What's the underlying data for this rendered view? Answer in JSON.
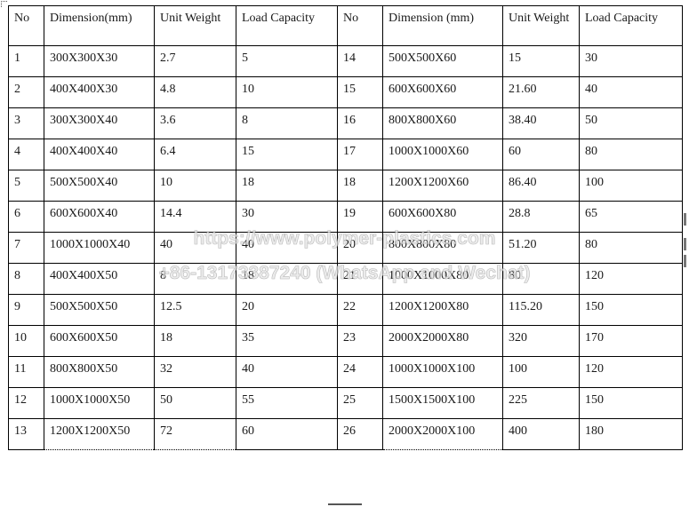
{
  "table": {
    "headers": [
      "No",
      "Dimension(mm)",
      "Unit Weight",
      "Load Capacity",
      "No",
      "Dimension (mm)",
      "Unit Weight",
      "Load Capacity"
    ],
    "rows": [
      [
        "1",
        "300X300X30",
        "2.7",
        "5",
        "14",
        "500X500X60",
        "15",
        "30"
      ],
      [
        "2",
        "400X400X30",
        "4.8",
        "10",
        "15",
        "600X600X60",
        "21.60",
        "40"
      ],
      [
        "3",
        "300X300X40",
        "3.6",
        "8",
        "16",
        "800X800X60",
        "38.40",
        "50"
      ],
      [
        "4",
        "400X400X40",
        "6.4",
        "15",
        "17",
        "1000X1000X60",
        "60",
        "80"
      ],
      [
        "5",
        "500X500X40",
        "10",
        "18",
        "18",
        "1200X1200X60",
        "86.40",
        "100"
      ],
      [
        "6",
        "600X600X40",
        "14.4",
        "30",
        "19",
        "600X600X80",
        "28.8",
        "65"
      ],
      [
        "7",
        "1000X1000X40",
        "40",
        "40",
        "20",
        "800X800X80",
        "51.20",
        "80"
      ],
      [
        "8",
        "400X400X50",
        "8",
        "18",
        "21",
        "1000X1000X80",
        "80",
        "120"
      ],
      [
        "9",
        "500X500X50",
        "12.5",
        "20",
        "22",
        "1200X1200X80",
        "115.20",
        "150"
      ],
      [
        "10",
        "600X600X50",
        "18",
        "35",
        "23",
        "2000X2000X80",
        "320",
        "170"
      ],
      [
        "11",
        "800X800X50",
        "32",
        "40",
        "24",
        "1000X1000X100",
        "100",
        "120"
      ],
      [
        "12",
        "1000X1000X50",
        "50",
        "55",
        "25",
        "1500X1500X100",
        "225",
        "150"
      ],
      [
        "13",
        "1200X1200X50",
        "72",
        "60",
        "26",
        "2000X2000X100",
        "400",
        "180"
      ]
    ]
  },
  "watermark": {
    "line1": "https://www.polymer-plastics.com",
    "line2": "+86-13173387240 (WhatsApp and Wechat)"
  }
}
